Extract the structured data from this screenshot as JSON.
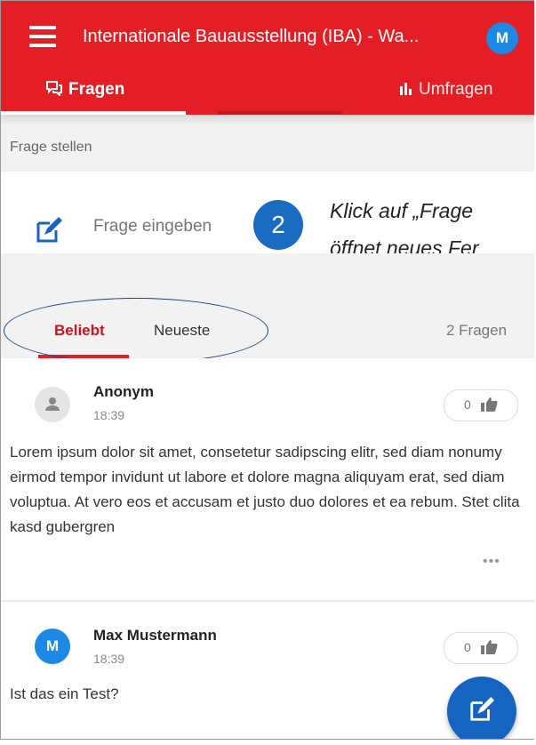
{
  "header": {
    "title": "Internationale Bauausstellung (IBA) - Wa...",
    "avatar_initial": "M",
    "tabs": [
      {
        "label": "Fragen",
        "icon": "chat-bubbles-icon"
      },
      {
        "label": "Umfragen",
        "icon": "bar-chart-icon"
      }
    ]
  },
  "ask": {
    "section_label": "Frage stellen",
    "placeholder": "Frage eingeben"
  },
  "annotation": {
    "step": "2",
    "line1": "Klick auf „Frage",
    "line2": "öffnet neues Fer"
  },
  "sort": {
    "tabs": [
      "Beliebt",
      "Neueste"
    ],
    "count": "2 Fragen"
  },
  "questions": [
    {
      "author": "Anonym",
      "time": "18:39",
      "likes": "0",
      "text": "Lorem ipsum dolor sit amet, consetetur sadipscing elitr, sed diam nonumy eirmod tempor invidunt ut labore et dolore magna aliquyam erat, sed diam voluptua. At vero eos et accusam et justo duo dolores et ea rebum. Stet clita kasd gubergren",
      "more": "•••"
    },
    {
      "author": "Max Mustermann",
      "avatar_initial": "M",
      "time": "18:39",
      "likes": "0",
      "text": "Ist das ein Test?"
    }
  ],
  "colors": {
    "brand_red": "#e31e24",
    "accent_blue": "#1565c0"
  }
}
